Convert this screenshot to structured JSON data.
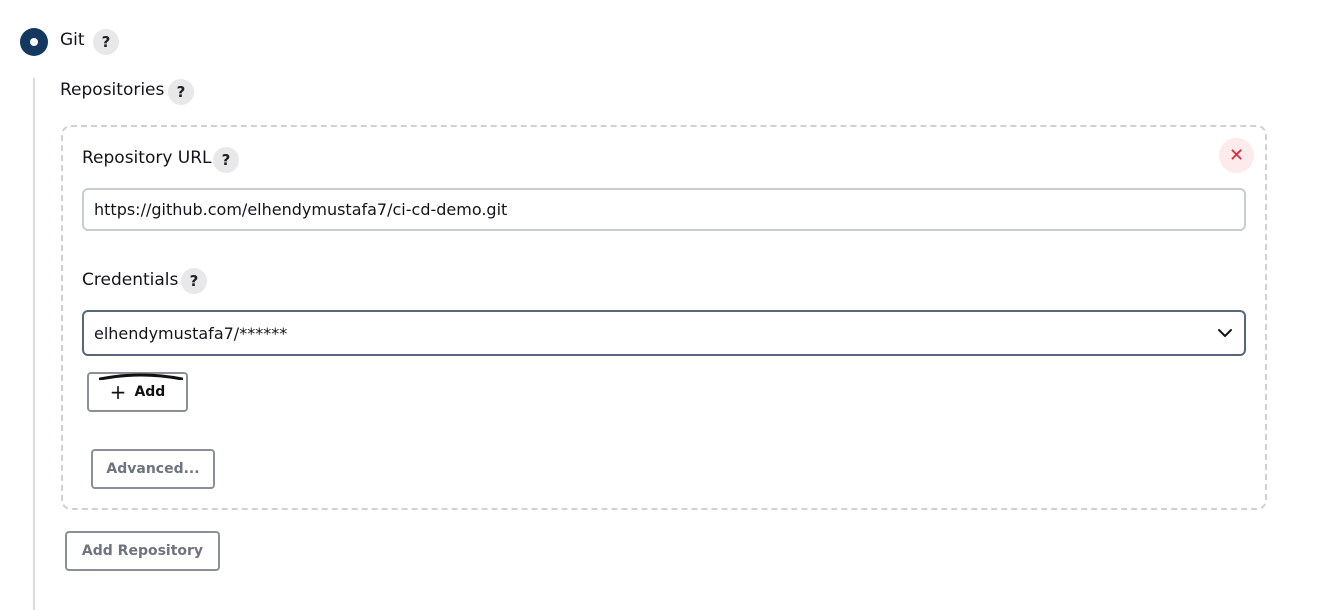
{
  "scm": {
    "option_label": "Git",
    "selected": true
  },
  "repositories": {
    "label": "Repositories",
    "items": [
      {
        "url_label": "Repository URL",
        "url_value": "https://github.com/elhendymustafa7/ci-cd-demo.git",
        "credentials_label": "Credentials",
        "credentials_value": "elhendymustafa7/******",
        "add_label": "Add",
        "advanced_label": "Advanced...",
        "remove_icon": "close-icon"
      }
    ],
    "add_repository_label": "Add Repository"
  },
  "help": {
    "symbol": "?"
  },
  "colors": {
    "radio": "#15395e",
    "remove_bg": "#fdeaea",
    "remove_fg": "#d9253a"
  }
}
